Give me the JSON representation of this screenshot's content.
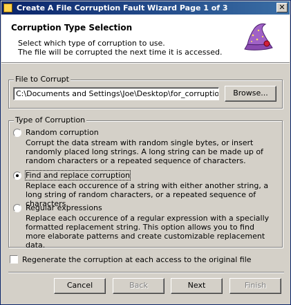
{
  "window": {
    "title": "Create A File Corruption Fault Wizard Page 1 of 3",
    "close_glyph": "✕"
  },
  "header": {
    "title": "Corruption Type Selection",
    "subtitle_line1": "Select which type of corruption to use.",
    "subtitle_line2": "The file will be corrupted the next time it is accessed."
  },
  "file_group": {
    "legend": "File to Corrupt",
    "path_value": "C:\\Documents and Settings\\Joe\\Desktop\\for_corruption.txt",
    "browse_label": "Browse..."
  },
  "type_group": {
    "legend": "Type of Corruption",
    "options": [
      {
        "label": "Random corruption",
        "selected": false,
        "desc": "Corrupt the data stream with random single bytes, or insert randomly placed long strings.  A long string can be made up of random characters or a repeated sequence of characters."
      },
      {
        "label": "Find and replace corruption",
        "selected": true,
        "desc": "Replace each occurence of a string with either another string, a long string of random characters, or a repeated sequence of characters."
      },
      {
        "label": "Regular expressions",
        "selected": false,
        "desc": "Replace each occurence of a regular expression with a specially formatted replacement string.  This option allows you to find more elaborate patterns and create customizable replacement data."
      }
    ]
  },
  "regenerate": {
    "label": "Regenerate the corruption at each access to the original file",
    "checked": false
  },
  "buttons": {
    "cancel": "Cancel",
    "back": "Back",
    "next": "Next",
    "finish": "Finish"
  },
  "icons": {
    "app": "wizard-app-icon",
    "header": "wizard-hat-icon"
  },
  "colors": {
    "titlebar_start": "#0a246a",
    "titlebar_end": "#3a6ea5",
    "face": "#d4d0c8"
  }
}
